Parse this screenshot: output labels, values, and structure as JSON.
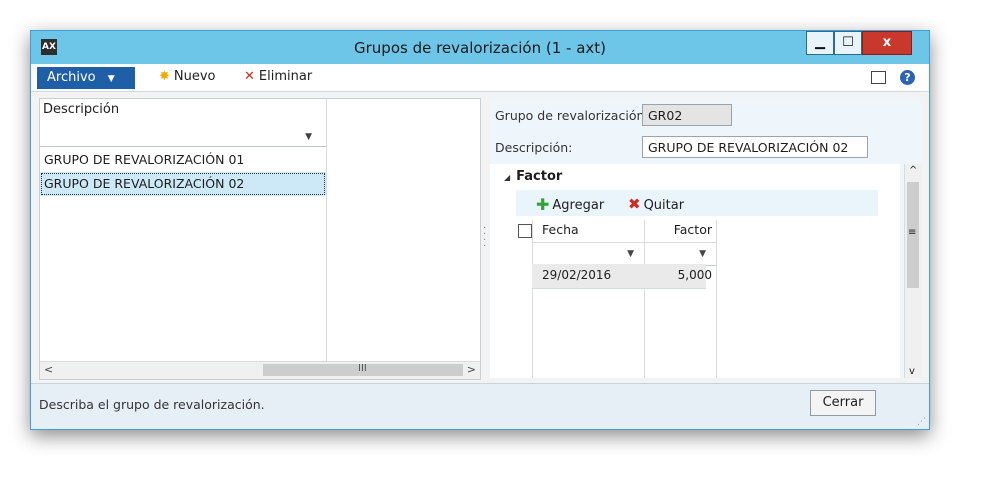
{
  "window": {
    "title": "Grupos de revalorización (1 - axt)",
    "min_glyph": "▁",
    "max_glyph": "☐",
    "close_glyph": "x",
    "icon_glyph": "AX"
  },
  "ribbon": {
    "archivo_label": "Archivo",
    "nuevo_label": "Nuevo",
    "eliminar_label": "Eliminar",
    "icons": [
      "sun-icon",
      "x-icon",
      "layout-icon",
      "help-icon"
    ]
  },
  "list": {
    "column_header": "Descripción",
    "rows": [
      "GRUPO DE REVALORIZACIÓN 01",
      "GRUPO DE REVALORIZACIÓN 02"
    ],
    "selected_index": 1
  },
  "detail": {
    "grupo_label": "Grupo de revalorización:",
    "grupo_value": "GR02",
    "descripcion_label": "Descripción:",
    "descripcion_value": "GRUPO DE REVALORIZACIÓN 02",
    "fasttab_title": "Factor",
    "agregar_label": "Agregar",
    "quitar_label": "Quitar",
    "columns": [
      "Fecha",
      "Factor"
    ],
    "rows": [
      {
        "fecha": "29/02/2016",
        "factor": "5,000"
      }
    ]
  },
  "status": {
    "message": "Describa el grupo de revalorización.",
    "close_label": "Cerrar"
  },
  "colors": {
    "titlebar": "#6dc6e8",
    "archivo": "#1f5fa8",
    "selection": "#cde8f7",
    "close": "#c8382d"
  }
}
